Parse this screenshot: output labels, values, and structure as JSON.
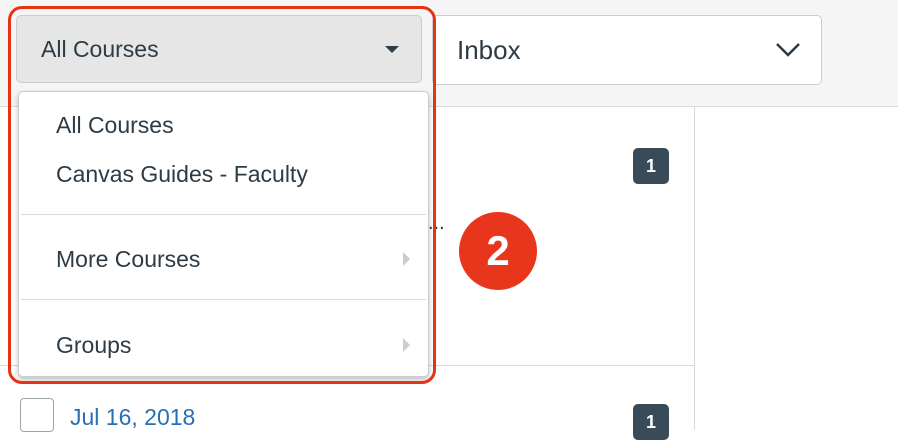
{
  "course_filter": {
    "selected": "All Courses",
    "options": [
      {
        "label": "All Courses",
        "has_submenu": false
      },
      {
        "label": "Canvas Guides - Faculty",
        "has_submenu": false
      },
      {
        "label": "More Courses",
        "has_submenu": true
      },
      {
        "label": "Groups",
        "has_submenu": true
      }
    ]
  },
  "mailbox_filter": {
    "selected": "Inbox"
  },
  "conversations": [
    {
      "count_badge": "1"
    },
    {
      "date": "Jul 16, 2018",
      "count_badge": "1"
    }
  ],
  "annotation": {
    "step_number": "2",
    "color": "#e8361c"
  },
  "ellipsis": "..."
}
